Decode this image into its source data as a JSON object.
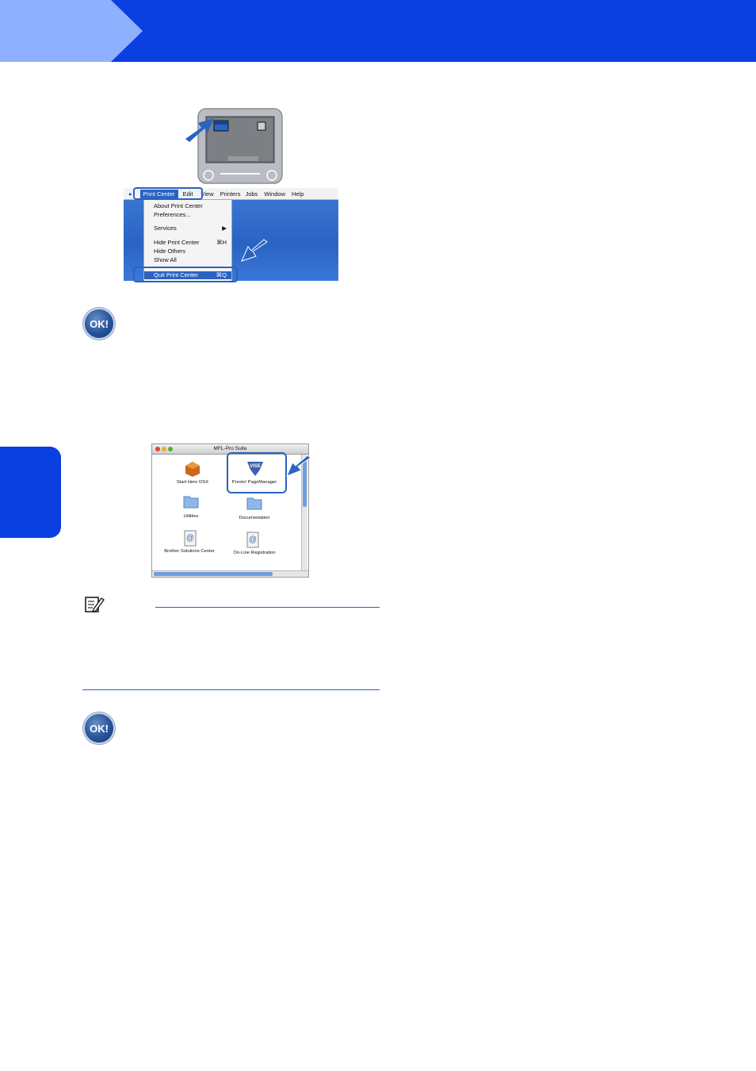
{
  "colors": {
    "header_blue": "#0a3fe0",
    "header_tab": "#8fb0ff",
    "accent": "#2a63c2"
  },
  "icons": [
    "mac-monitor-icon",
    "arrow-icon",
    "apple-icon",
    "ok-badge-icon",
    "note-icon",
    "folder-icon",
    "package-icon",
    "web-doc-icon",
    "vise-icon"
  ],
  "menu": {
    "bar": [
      "Print Center",
      "Edit",
      "View",
      "Printers",
      "Jobs",
      "Window",
      "Help"
    ],
    "items": [
      {
        "label": "About Print Center",
        "shortcut": ""
      },
      {
        "label": "Preferences...",
        "shortcut": ""
      },
      {
        "label": "Services",
        "shortcut": "▶"
      },
      {
        "label": "Hide Print Center",
        "shortcut": "⌘H"
      },
      {
        "label": "Hide Others",
        "shortcut": ""
      },
      {
        "label": "Show All",
        "shortcut": ""
      },
      {
        "label": "Quit Print Center",
        "shortcut": "⌘Q"
      }
    ]
  },
  "ok_badges": [
    "OK!",
    "OK!"
  ],
  "finder": {
    "title": "MFL-Pro Suite",
    "items": [
      "Start Here OSX",
      "Presto! PageManager",
      "Utilities",
      "Documentation",
      "Brother Solutions Center",
      "On-Line Registration"
    ],
    "vise_label": "VISE"
  }
}
